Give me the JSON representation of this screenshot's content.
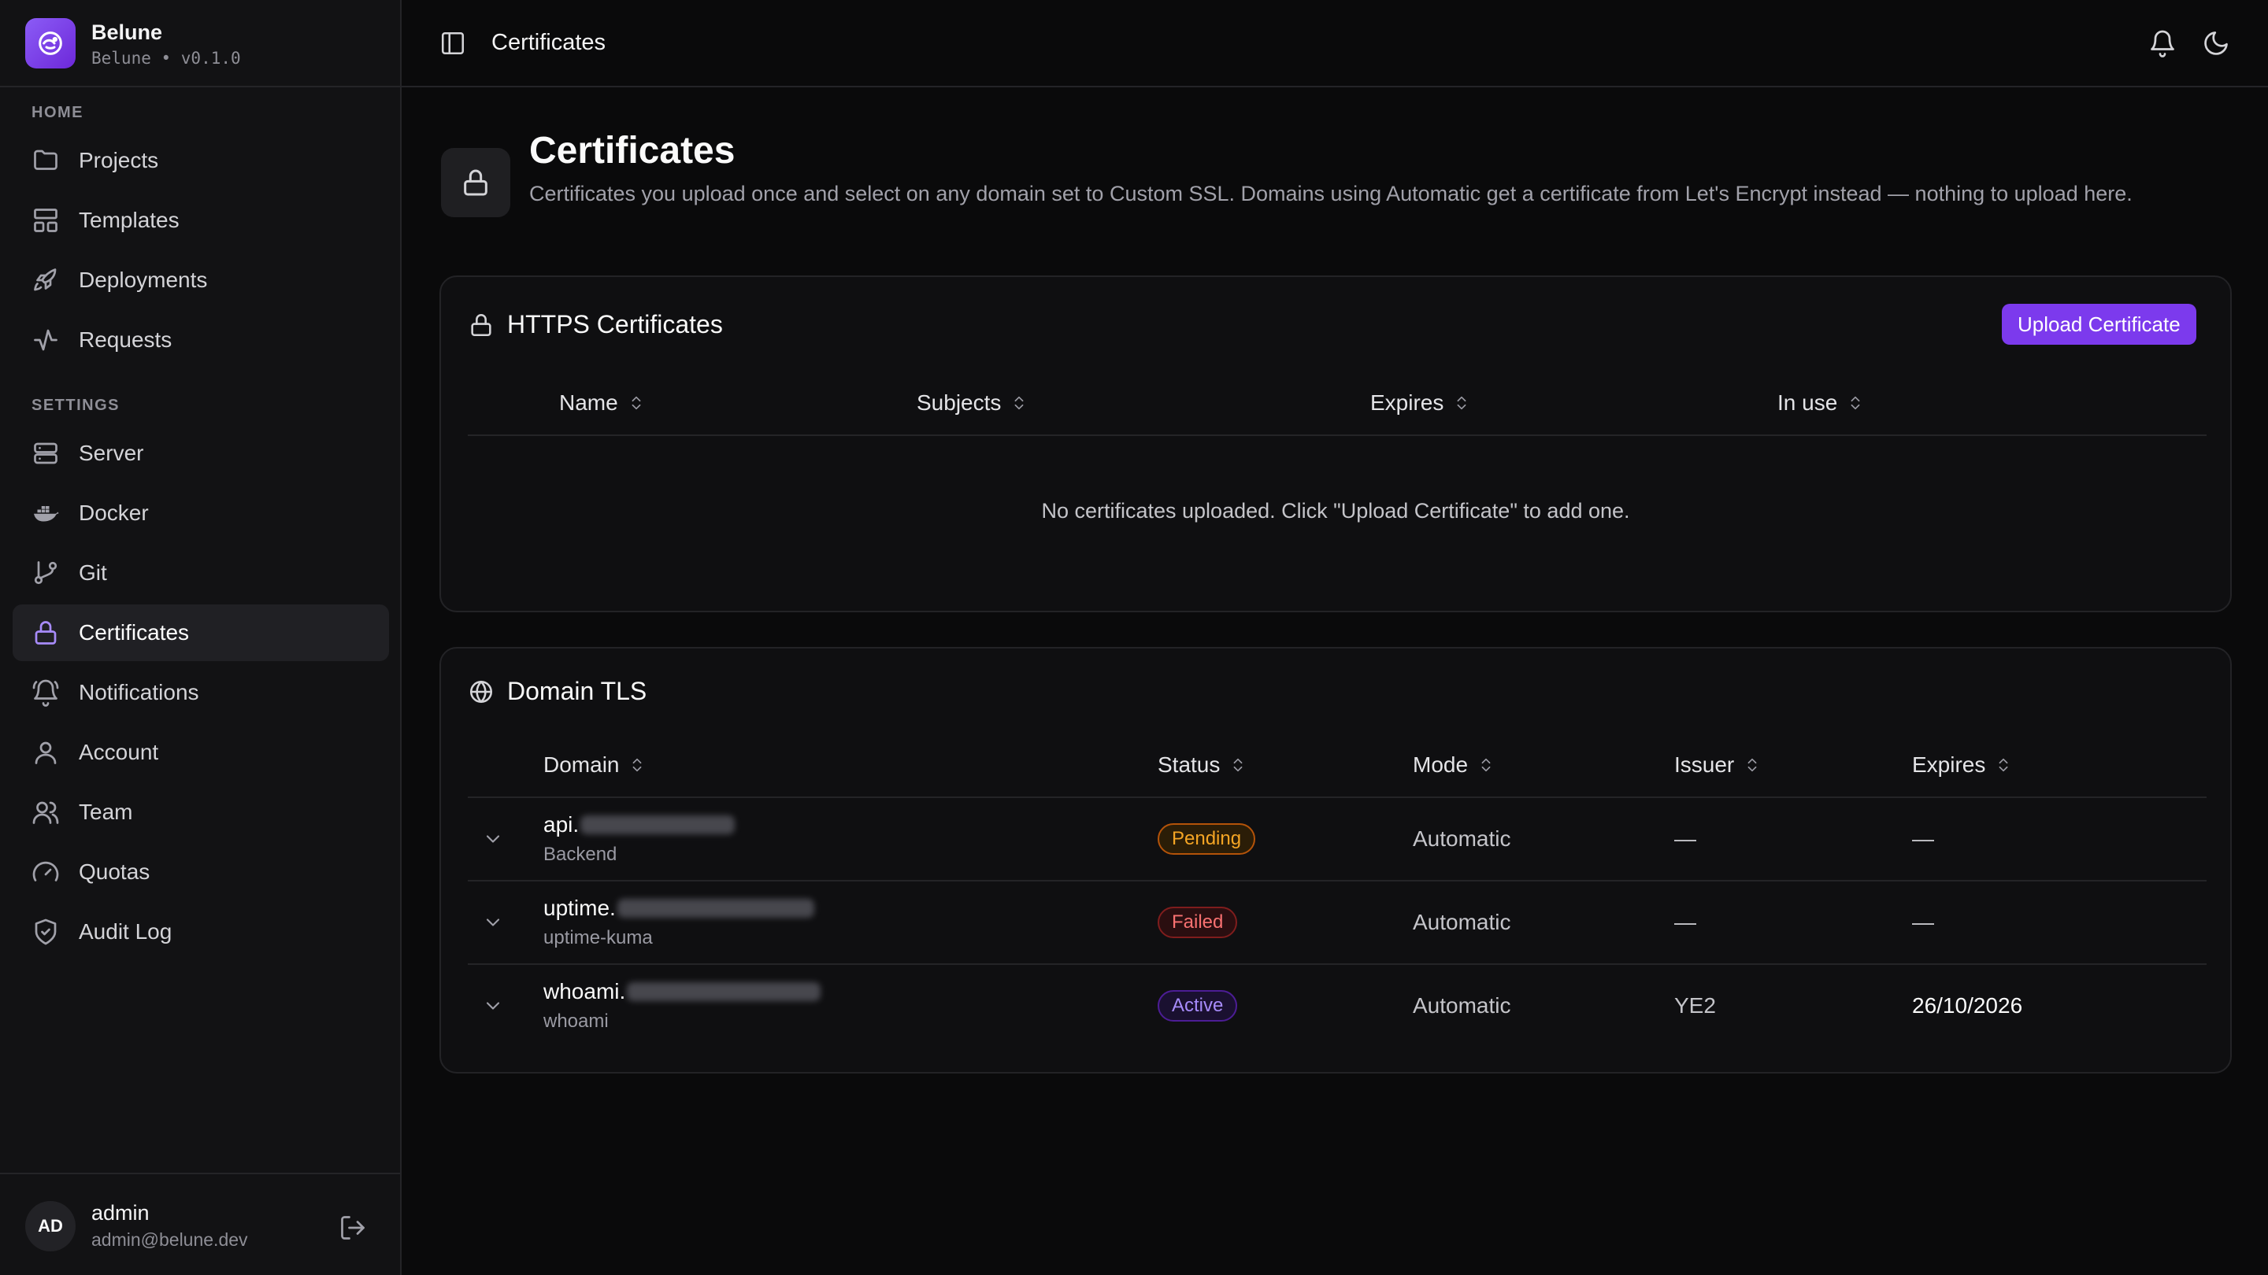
{
  "app": {
    "name": "Belune",
    "version_line": "Belune • v0.1.0"
  },
  "colors": {
    "accent": "#7c3aed",
    "pending": "#f59e0b",
    "failed": "#ef4444",
    "active": "#8b5cf6"
  },
  "sidebar": {
    "sections": [
      {
        "label": "HOME",
        "items": [
          {
            "label": "Projects",
            "icon": "folder-icon"
          },
          {
            "label": "Templates",
            "icon": "layout-icon"
          },
          {
            "label": "Deployments",
            "icon": "rocket-icon"
          },
          {
            "label": "Requests",
            "icon": "activity-icon"
          }
        ]
      },
      {
        "label": "SETTINGS",
        "items": [
          {
            "label": "Server",
            "icon": "server-icon"
          },
          {
            "label": "Docker",
            "icon": "docker-icon"
          },
          {
            "label": "Git",
            "icon": "git-branch-icon"
          },
          {
            "label": "Certificates",
            "icon": "lock-icon",
            "active": true
          },
          {
            "label": "Notifications",
            "icon": "bell-ring-icon"
          },
          {
            "label": "Account",
            "icon": "user-icon"
          },
          {
            "label": "Team",
            "icon": "users-icon"
          },
          {
            "label": "Quotas",
            "icon": "gauge-icon"
          },
          {
            "label": "Audit Log",
            "icon": "shield-check-icon"
          }
        ]
      }
    ],
    "user": {
      "initials": "AD",
      "name": "admin",
      "email": "admin@belune.dev"
    }
  },
  "topbar": {
    "title": "Certificates"
  },
  "page": {
    "title": "Certificates",
    "description": "Certificates you upload once and select on any domain set to Custom SSL. Domains using Automatic get a certificate from Let's Encrypt instead — nothing to upload here."
  },
  "https_card": {
    "title": "HTTPS Certificates",
    "upload_label": "Upload Certificate",
    "columns": [
      "Name",
      "Subjects",
      "Expires",
      "In use"
    ],
    "empty_text": "No certificates uploaded. Click \"Upload Certificate\" to add one."
  },
  "tls_card": {
    "title": "Domain TLS",
    "columns": [
      "Domain",
      "Status",
      "Mode",
      "Issuer",
      "Expires"
    ],
    "rows": [
      {
        "domain_prefix": "api.",
        "service": "Backend",
        "status": "Pending",
        "mode": "Automatic",
        "issuer": "—",
        "expires": "—"
      },
      {
        "domain_prefix": "uptime.",
        "service": "uptime-kuma",
        "status": "Failed",
        "mode": "Automatic",
        "issuer": "—",
        "expires": "—"
      },
      {
        "domain_prefix": "whoami.",
        "service": "whoami",
        "status": "Active",
        "mode": "Automatic",
        "issuer": "YE2",
        "expires": "26/10/2026"
      }
    ]
  }
}
